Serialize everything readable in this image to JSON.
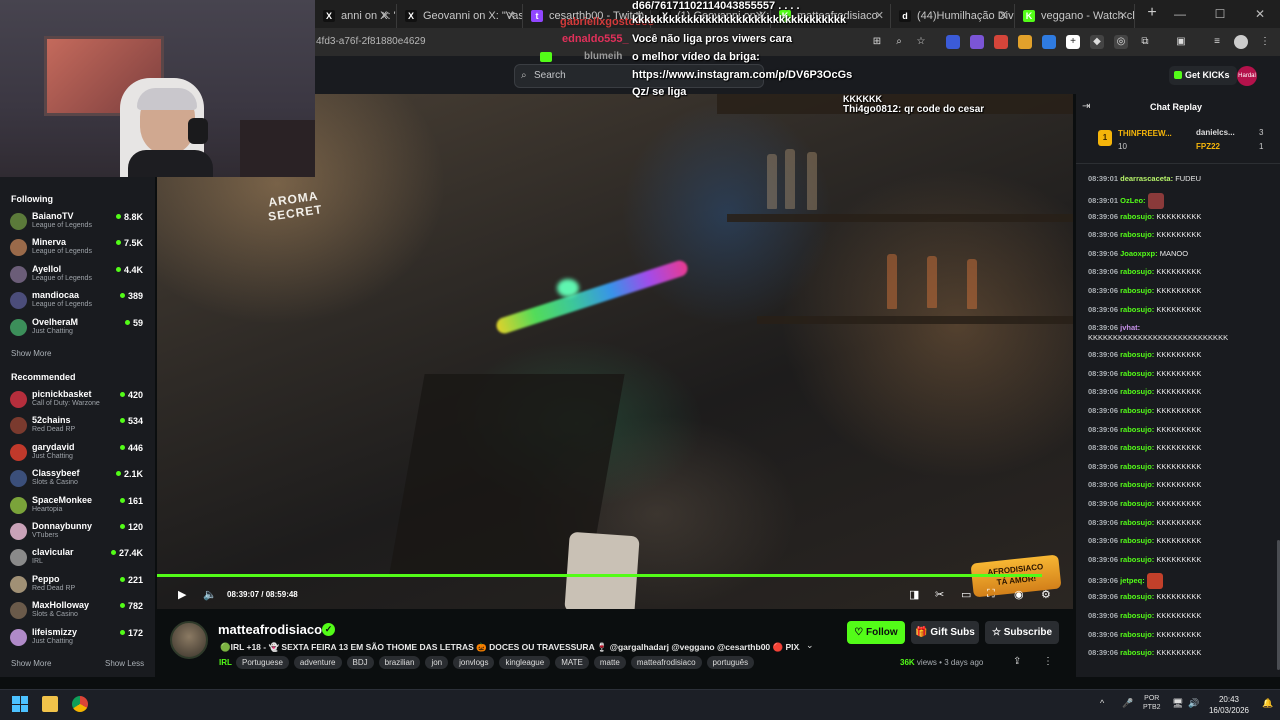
{
  "browser": {
    "tabs": [
      {
        "label": "anni on X: \"Vasc",
        "fav_color": "#111111",
        "fav": "X"
      },
      {
        "label": "Geovanni on X: \"Vasc",
        "fav_color": "#111111",
        "fav": "X"
      },
      {
        "label": "cesarthb00 - Twitch",
        "fav_color": "#9146ff",
        "fav": "t"
      },
      {
        "label": "(1) Geovanni on X: \"",
        "fav_color": "#111111",
        "fav": "X"
      },
      {
        "label": "matteafrodisiaco",
        "fav_color": "#53fc18",
        "fav": "K"
      },
      {
        "label": "(44)Humilhação Dive",
        "fav_color": "#111111",
        "fav": "d"
      },
      {
        "label": "veggano - Watch cli",
        "fav_color": "#53fc18",
        "fav": "K"
      }
    ],
    "new_tab": "+",
    "url_fragment": "4fd3-a76f-2f81880e4629"
  },
  "header": {
    "search_placeholder": "Search",
    "get_kicks": "Get KICKs",
    "user_avatar": "Hardal"
  },
  "overlay_chat": {
    "user_top": "gabriellxgostosos",
    "msg_top": "d66/76171102114043855557 . . . .",
    "msg_kkk": "kkkkkkkkkkkkkkkkkkkkkkkkkkkkkkkkkkk",
    "user2": "ednaldo555_",
    "msg2_line1": "Você não liga pros viwers cara",
    "msg2_line2": "o melhor vídeo da briga:",
    "msg2_line3": "https://www.instagram.com/p/DV6P3OcGs",
    "msg2_line4": "Qz/ se liga",
    "user3": "blumeih",
    "video_chat_1": "KKKKKK",
    "video_chat_2_user": "Thi4go0812:",
    "video_chat_2_text": "qr code do cesar"
  },
  "sidebar": {
    "following_title": "Following",
    "following": [
      {
        "name": "BaianoTV",
        "category": "League of Legends",
        "viewers": "8.8K",
        "color": "#5b7a3a"
      },
      {
        "name": "Minerva",
        "category": "League of Legends",
        "viewers": "7.5K",
        "color": "#9a6a4a"
      },
      {
        "name": "Ayellol",
        "category": "League of Legends",
        "viewers": "4.4K",
        "color": "#6b5d78"
      },
      {
        "name": "mandiocaa",
        "category": "League of Legends",
        "viewers": "389",
        "color": "#4b4d7a"
      },
      {
        "name": "OvelheraM",
        "category": "Just Chatting",
        "viewers": "59",
        "color": "#3c8f5a"
      }
    ],
    "show_more_1": "Show More",
    "recommended_title": "Recommended",
    "recommended": [
      {
        "name": "picnickbasket",
        "category": "Call of Duty: Warzone",
        "viewers": "420",
        "color": "#b52e3c"
      },
      {
        "name": "52chains",
        "category": "Red Dead RP",
        "viewers": "534",
        "color": "#7a3a2e"
      },
      {
        "name": "garydavid",
        "category": "Just Chatting",
        "viewers": "446",
        "color": "#c0392b"
      },
      {
        "name": "Classybeef",
        "category": "Slots & Casino",
        "viewers": "2.1K",
        "color": "#3b4f7a"
      },
      {
        "name": "SpaceMonkee",
        "category": "Heartopia",
        "viewers": "161",
        "color": "#7aa33a"
      },
      {
        "name": "Donnaybunny",
        "category": "VTubers",
        "viewers": "120",
        "color": "#c9a2b8"
      },
      {
        "name": "clavicular",
        "category": "IRL",
        "viewers": "27.4K",
        "color": "#8a8a8a"
      },
      {
        "name": "Peppo",
        "category": "Red Dead RP",
        "viewers": "221",
        "color": "#a09075"
      },
      {
        "name": "MaxHolloway",
        "category": "Slots & Casino",
        "viewers": "782",
        "color": "#6a5a4a"
      },
      {
        "name": "lifeismizzy",
        "category": "Just Chatting",
        "viewers": "172",
        "color": "#b08ac8"
      }
    ],
    "show_more_2": "Show More",
    "show_less": "Show Less"
  },
  "video": {
    "sign_line1": "AROMA",
    "sign_line2": "SECRET",
    "current_time": "08:39:07",
    "separator": "/",
    "duration": "08:59:48",
    "progress_fraction": 0.9665,
    "overlay_logo_line1": "AFRODISIACO",
    "overlay_logo_line2": "TÁ AMOR!"
  },
  "stream_info": {
    "channel": "matteafrodisiaco",
    "title": "🟢IRL +18 - 👻 SEXTA FEIRA 13 EM SÃO THOME DAS LETRAS 🎃 DOCES OU TRAVESSURA 🍷 @gargalhadarj @veggano @cesarthb00 🔴 PIX...",
    "category": "IRL",
    "tags": [
      "Portuguese",
      "adventure",
      "BDJ",
      "brazilian",
      "jon",
      "jonvlogs",
      "kingleague",
      "MATE",
      "matte",
      "matteafrodisiaco",
      "português"
    ],
    "follow": "Follow",
    "gift_subs": "Gift Subs",
    "subscribe": "Subscribe",
    "views_count": "36K",
    "views_label": "views",
    "dot": "•",
    "age": "3 days ago"
  },
  "chat": {
    "title": "Chat Replay",
    "gifters": [
      {
        "rank": "1",
        "name": "THINFREEW...",
        "count": "10"
      },
      {
        "rank": "2",
        "name": "danielcs...",
        "count": "3"
      },
      {
        "rank": "3",
        "name": "FPZ22",
        "count": "1"
      }
    ],
    "messages": [
      {
        "time": "08:39:01",
        "user": "dearrascaceta:",
        "text": "FUDEU",
        "color": "#b6f36a"
      },
      {
        "time": "08:39:01",
        "user": "OzLeo:",
        "text": "",
        "color": "#53fc18",
        "emote": "#8a3a3a"
      },
      {
        "time": "08:39:06",
        "user": "rabosujo:",
        "text": "KKKKKKKKK",
        "color": "#53fc18"
      },
      {
        "time": "08:39:06",
        "user": "rabosujo:",
        "text": "KKKKKKKKK",
        "color": "#53fc18"
      },
      {
        "time": "08:39:06",
        "user": "Joaoxpxp:",
        "text": "MANOO",
        "color": "#53fc18"
      },
      {
        "time": "08:39:06",
        "user": "rabosujo:",
        "text": "KKKKKKKKK",
        "color": "#53fc18"
      },
      {
        "time": "08:39:06",
        "user": "rabosujo:",
        "text": "KKKKKKKKK",
        "color": "#53fc18"
      },
      {
        "time": "08:39:06",
        "user": "rabosujo:",
        "text": "KKKKKKKKK",
        "color": "#53fc18"
      },
      {
        "time": "08:39:06",
        "user": "jvhat:",
        "text": "KKKKKKKKKKKKKKKKKKKKKKKKKKKK",
        "color": "#c792ea"
      },
      {
        "time": "08:39:06",
        "user": "rabosujo:",
        "text": "KKKKKKKKK",
        "color": "#53fc18"
      },
      {
        "time": "08:39:06",
        "user": "rabosujo:",
        "text": "KKKKKKKKK",
        "color": "#53fc18"
      },
      {
        "time": "08:39:06",
        "user": "rabosujo:",
        "text": "KKKKKKKKK",
        "color": "#53fc18"
      },
      {
        "time": "08:39:06",
        "user": "rabosujo:",
        "text": "KKKKKKKKK",
        "color": "#53fc18"
      },
      {
        "time": "08:39:06",
        "user": "rabosujo:",
        "text": "KKKKKKKKK",
        "color": "#53fc18"
      },
      {
        "time": "08:39:06",
        "user": "rabosujo:",
        "text": "KKKKKKKKK",
        "color": "#53fc18"
      },
      {
        "time": "08:39:06",
        "user": "rabosujo:",
        "text": "KKKKKKKKK",
        "color": "#53fc18"
      },
      {
        "time": "08:39:06",
        "user": "rabosujo:",
        "text": "KKKKKKKKK",
        "color": "#53fc18"
      },
      {
        "time": "08:39:06",
        "user": "rabosujo:",
        "text": "KKKKKKKKK",
        "color": "#53fc18"
      },
      {
        "time": "08:39:06",
        "user": "rabosujo:",
        "text": "KKKKKKKKK",
        "color": "#53fc18"
      },
      {
        "time": "08:39:06",
        "user": "rabosujo:",
        "text": "KKKKKKKKK",
        "color": "#53fc18"
      },
      {
        "time": "08:39:06",
        "user": "rabosujo:",
        "text": "KKKKKKKKK",
        "color": "#53fc18"
      },
      {
        "time": "08:39:06",
        "user": "jetpeq:",
        "text": "",
        "color": "#53fc18",
        "emote": "#c2402a"
      },
      {
        "time": "08:39:06",
        "user": "rabosujo:",
        "text": "KKKKKKKKK",
        "color": "#53fc18"
      },
      {
        "time": "08:39:06",
        "user": "rabosujo:",
        "text": "KKKKKKKKK",
        "color": "#53fc18"
      },
      {
        "time": "08:39:06",
        "user": "rabosujo:",
        "text": "KKKKKKKKK",
        "color": "#53fc18"
      },
      {
        "time": "08:39:06",
        "user": "rabosujo:",
        "text": "KKKKKKKKK",
        "color": "#53fc18"
      }
    ]
  },
  "taskbar": {
    "lang_line1": "POR",
    "lang_line2": "PTB2",
    "time": "20:43",
    "date": "16/03/2026"
  },
  "colors": {
    "accent": "#53fc18",
    "panel": "#191b1f",
    "background": "#0b0e0f"
  }
}
